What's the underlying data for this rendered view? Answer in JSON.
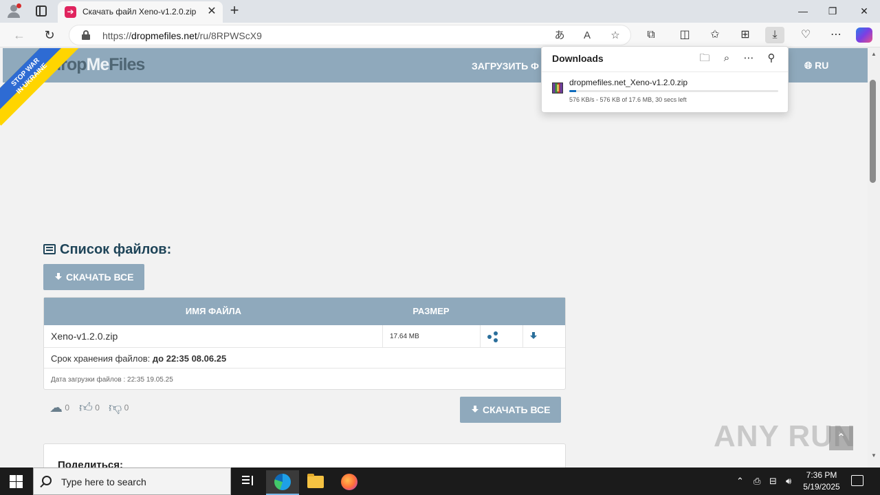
{
  "browser": {
    "tab_title": "Скачать файл Xeno-v1.2.0.zip",
    "url_prefix": "https://",
    "url_host": "dropmefiles.net",
    "url_path": "/ru/8RPWScX9",
    "window_controls": {
      "minimize": "—",
      "restore": "❐",
      "close": "✕"
    }
  },
  "downloads_panel": {
    "title": "Downloads",
    "item": {
      "filename": "dropmefiles.net_Xeno-v1.2.0.zip",
      "status": "576 KB/s - 576 KB of 17.6 MB, 30 secs left",
      "progress_fraction": 0.033
    }
  },
  "site": {
    "logo_drop": "drop",
    "logo_me": "Me",
    "logo_files": "Files",
    "ribbon_line1": "STOP WAR",
    "ribbon_line2": "IN UKRAINE",
    "nav_upload": "ЗАГРУЗИТЬ Ф",
    "nav_lang": "RU"
  },
  "files": {
    "section_title": "Список файлов:",
    "download_all": "СКАЧАТЬ ВСЕ",
    "col_name": "ИМЯ ФАЙЛА",
    "col_size": "РАЗМЕР",
    "rows": [
      {
        "name": "Xeno-v1.2.0.zip",
        "size": "17.64 MB"
      }
    ],
    "storage_label": "Срок хранения файлов:",
    "storage_value": "до 22:35 08.06.25",
    "upload_date": "Дата загрузки файлов : 22:35 19.05.25"
  },
  "stats": {
    "downloads": "0",
    "likes": "0",
    "dislikes": "0"
  },
  "share_card_title": "Поделиться:",
  "watermark": "ANY RUN",
  "taskbar": {
    "search_placeholder": "Type here to search",
    "time": "7:36 PM",
    "date": "5/19/2025"
  },
  "colors": {
    "site_accent": "#8fa9bc",
    "title_color": "#1e4458",
    "progress": "#0f6cbd"
  }
}
